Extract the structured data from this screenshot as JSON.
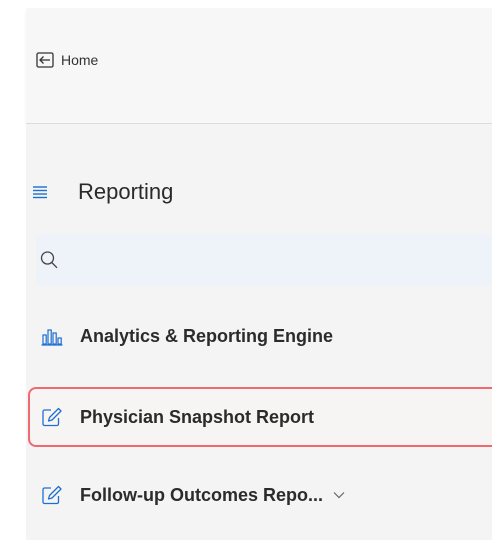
{
  "header": {
    "home_label": "Home",
    "home_icon": "back-arrow-box-icon"
  },
  "section": {
    "title": "Reporting",
    "menu_icon": "hamburger-menu-icon",
    "accent_color": "#1f6fd1"
  },
  "search": {
    "placeholder": "",
    "value": "",
    "icon": "search-icon"
  },
  "nav_items": [
    {
      "label": "Analytics & Reporting Engine",
      "icon": "bar-chart-icon",
      "selected": false
    },
    {
      "label": "Physician Snapshot Report",
      "icon": "edit-icon",
      "selected": true,
      "highlight_color": "#ee6a70"
    },
    {
      "label": "Follow-up Outcomes Repo...",
      "icon": "edit-icon",
      "selected": false,
      "expandable": true,
      "chevron_icon": "chevron-down-icon"
    }
  ]
}
